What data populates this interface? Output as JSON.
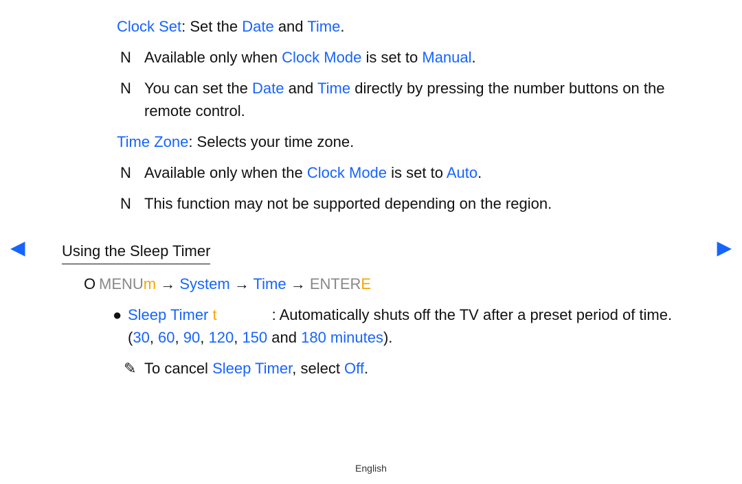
{
  "clockSet": {
    "label": "Clock Set",
    "text1": ": Set the ",
    "date": "Date",
    "and": " and ",
    "time": "Time",
    "period": "."
  },
  "notes": {
    "n1a": "Available only when ",
    "n1b": "Clock Mode",
    "n1c": " is set to ",
    "n1d": "Manual",
    "n1e": ".",
    "n2a": "You can set the ",
    "n2b": "Date",
    "n2c": " and ",
    "n2d": "Time",
    "n2e": " directly by pressing the number buttons on the remote control.",
    "tz1": "Time Zone",
    "tz2": ": Selects your time zone.",
    "n3a": "Available only when the ",
    "n3b": "Clock Mode",
    "n3c": " is set to ",
    "n3d": "Auto",
    "n3e": ".",
    "n4": "This function may not be supported depending on the region."
  },
  "section": {
    "heading": "Using the Sleep Timer"
  },
  "menuPath": {
    "menu": "MENU",
    "m": "m",
    "arrow1": "  → ",
    "system": "System",
    "arrow2": " → ",
    "time": "Time",
    "arrow3": " → ",
    "enter": "ENTER",
    "e": "E"
  },
  "sleepTimer": {
    "label": "Sleep Timer",
    "t": " t",
    "desc1": ": Automatically shuts off the TV after a preset period of time. (",
    "v30": "30",
    "c1": ", ",
    "v60": "60",
    "c2": ", ",
    "v90": "90",
    "c3": ", ",
    "v120": "120",
    "c4": ", ",
    "v150": "150",
    "c5": " and ",
    "v180": "180 minutes",
    "end": ")."
  },
  "cancel": {
    "a": "To cancel ",
    "b": "Sleep Timer",
    "c": ", select ",
    "d": "Off",
    "e": "."
  },
  "markers": {
    "n": "N",
    "o": "O",
    "bullet": "●",
    "noteIcon": "✎"
  },
  "nav": {
    "left": "◀",
    "right": "▶"
  },
  "footer": "English"
}
